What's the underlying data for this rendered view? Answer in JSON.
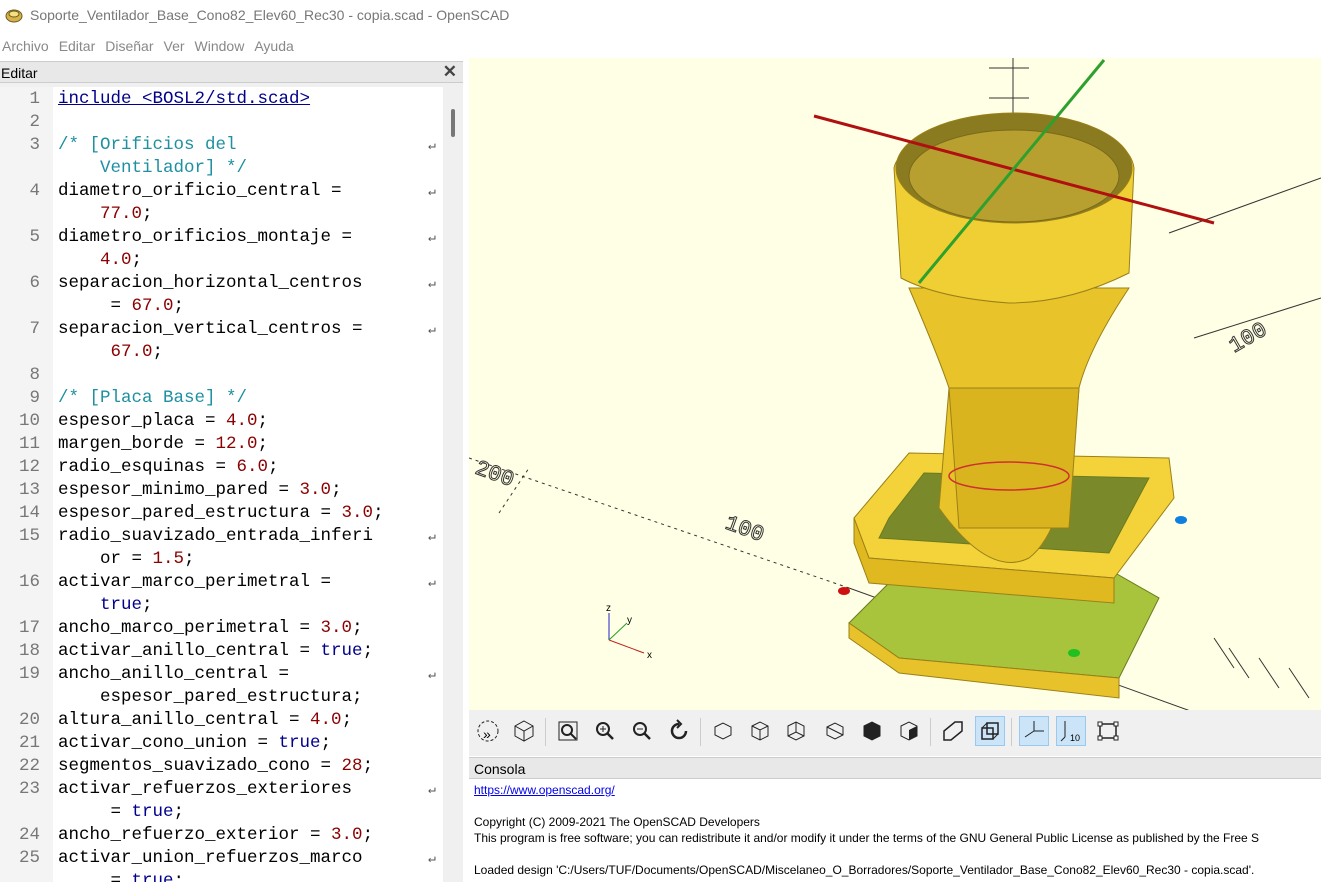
{
  "window": {
    "title": "Soporte_Ventilador_Base_Cono82_Elev60_Rec30 - copia.scad - OpenSCAD"
  },
  "menu": [
    "Archivo",
    "Editar",
    "Diseñar",
    "Ver",
    "Window",
    "Ayuda"
  ],
  "editor": {
    "title": "Editar",
    "close": "✕",
    "lines": [
      {
        "n": "1",
        "parts": [
          [
            "kw",
            "include <BOSL2/std.scad>"
          ]
        ]
      },
      {
        "n": "2",
        "parts": []
      },
      {
        "n": "3",
        "parts": [
          [
            "cm",
            "/* [Orificios del"
          ]
        ],
        "wrap": true
      },
      {
        "n": "",
        "parts": [
          [
            "cm",
            "    Ventilador] */"
          ]
        ]
      },
      {
        "n": "4",
        "parts": [
          [
            "",
            "diametro_orificio_central ="
          ]
        ],
        "wrap": true
      },
      {
        "n": "",
        "parts": [
          [
            "",
            "    "
          ],
          [
            "num",
            "77.0"
          ],
          [
            "",
            ";"
          ]
        ]
      },
      {
        "n": "5",
        "parts": [
          [
            "",
            "diametro_orificios_montaje ="
          ]
        ],
        "wrap": true
      },
      {
        "n": "",
        "parts": [
          [
            "",
            "    "
          ],
          [
            "num",
            "4.0"
          ],
          [
            "",
            ";"
          ]
        ]
      },
      {
        "n": "6",
        "parts": [
          [
            "",
            "separacion_horizontal_centros"
          ]
        ],
        "wrap": true
      },
      {
        "n": "",
        "parts": [
          [
            "",
            "     = "
          ],
          [
            "num",
            "67.0"
          ],
          [
            "",
            ";"
          ]
        ]
      },
      {
        "n": "7",
        "parts": [
          [
            "",
            "separacion_vertical_centros ="
          ]
        ],
        "wrap": true
      },
      {
        "n": "",
        "parts": [
          [
            "",
            "     "
          ],
          [
            "num",
            "67.0"
          ],
          [
            "",
            ";"
          ]
        ]
      },
      {
        "n": "8",
        "parts": []
      },
      {
        "n": "9",
        "parts": [
          [
            "cm",
            "/* [Placa Base] */"
          ]
        ]
      },
      {
        "n": "10",
        "parts": [
          [
            "",
            "espesor_placa = "
          ],
          [
            "num",
            "4.0"
          ],
          [
            "",
            ";"
          ]
        ]
      },
      {
        "n": "11",
        "parts": [
          [
            "",
            "margen_borde = "
          ],
          [
            "num",
            "12.0"
          ],
          [
            "",
            ";"
          ]
        ]
      },
      {
        "n": "12",
        "parts": [
          [
            "",
            "radio_esquinas = "
          ],
          [
            "num",
            "6.0"
          ],
          [
            "",
            ";"
          ]
        ]
      },
      {
        "n": "13",
        "parts": [
          [
            "",
            "espesor_minimo_pared = "
          ],
          [
            "num",
            "3.0"
          ],
          [
            "",
            ";"
          ]
        ]
      },
      {
        "n": "14",
        "parts": [
          [
            "",
            "espesor_pared_estructura = "
          ],
          [
            "num",
            "3.0"
          ],
          [
            "",
            ";"
          ]
        ]
      },
      {
        "n": "15",
        "parts": [
          [
            "",
            "radio_suavizado_entrada_inferi"
          ]
        ],
        "wrap": true
      },
      {
        "n": "",
        "parts": [
          [
            "",
            "    or = "
          ],
          [
            "num",
            "1.5"
          ],
          [
            "",
            ";"
          ]
        ]
      },
      {
        "n": "16",
        "parts": [
          [
            "",
            "activar_marco_perimetral ="
          ]
        ],
        "wrap": true
      },
      {
        "n": "",
        "parts": [
          [
            "",
            "    "
          ],
          [
            "kwt",
            "true"
          ],
          [
            "",
            ";"
          ]
        ]
      },
      {
        "n": "17",
        "parts": [
          [
            "",
            "ancho_marco_perimetral = "
          ],
          [
            "num",
            "3.0"
          ],
          [
            "",
            ";"
          ]
        ]
      },
      {
        "n": "18",
        "parts": [
          [
            "",
            "activar_anillo_central = "
          ],
          [
            "kwt",
            "true"
          ],
          [
            "",
            ";"
          ]
        ]
      },
      {
        "n": "19",
        "parts": [
          [
            "",
            "ancho_anillo_central ="
          ]
        ],
        "wrap": true
      },
      {
        "n": "",
        "parts": [
          [
            "",
            "    espesor_pared_estructura;"
          ]
        ]
      },
      {
        "n": "20",
        "parts": [
          [
            "",
            "altura_anillo_central = "
          ],
          [
            "num",
            "4.0"
          ],
          [
            "",
            ";"
          ]
        ]
      },
      {
        "n": "21",
        "parts": [
          [
            "",
            "activar_cono_union = "
          ],
          [
            "kwt",
            "true"
          ],
          [
            "",
            ";"
          ]
        ]
      },
      {
        "n": "22",
        "parts": [
          [
            "",
            "segmentos_suavizado_cono = "
          ],
          [
            "num",
            "28"
          ],
          [
            "",
            ";"
          ]
        ]
      },
      {
        "n": "23",
        "parts": [
          [
            "",
            "activar_refuerzos_exteriores"
          ]
        ],
        "wrap": true
      },
      {
        "n": "",
        "parts": [
          [
            "",
            "     = "
          ],
          [
            "kwt",
            "true"
          ],
          [
            "",
            ";"
          ]
        ]
      },
      {
        "n": "24",
        "parts": [
          [
            "",
            "ancho_refuerzo_exterior = "
          ],
          [
            "num",
            "3.0"
          ],
          [
            "",
            ";"
          ]
        ]
      },
      {
        "n": "25",
        "parts": [
          [
            "",
            "activar_union_refuerzos_marco"
          ]
        ],
        "wrap": true
      },
      {
        "n": "",
        "parts": [
          [
            "",
            "     = "
          ],
          [
            "kwt",
            "true"
          ],
          [
            "",
            ";"
          ]
        ]
      }
    ]
  },
  "viewport": {
    "axis_labels": [
      "200",
      "100",
      "100"
    ],
    "gizmo": {
      "x": "x",
      "y": "y",
      "z": "z"
    }
  },
  "toolbar": {
    "scale_label": "10"
  },
  "console": {
    "title": "Consola",
    "link": "https://www.openscad.org/",
    "line1": "Copyright (C) 2009-2021 The OpenSCAD Developers",
    "line2": "This program is free software; you can redistribute it and/or modify it under the terms of the GNU General Public License as published by the Free S",
    "line3": "Loaded design 'C:/Users/TUF/Documents/OpenSCAD/Miscelaneo_O_Borradores/Soporte_Ventilador_Base_Cono82_Elev60_Rec30 - copia.scad'."
  }
}
